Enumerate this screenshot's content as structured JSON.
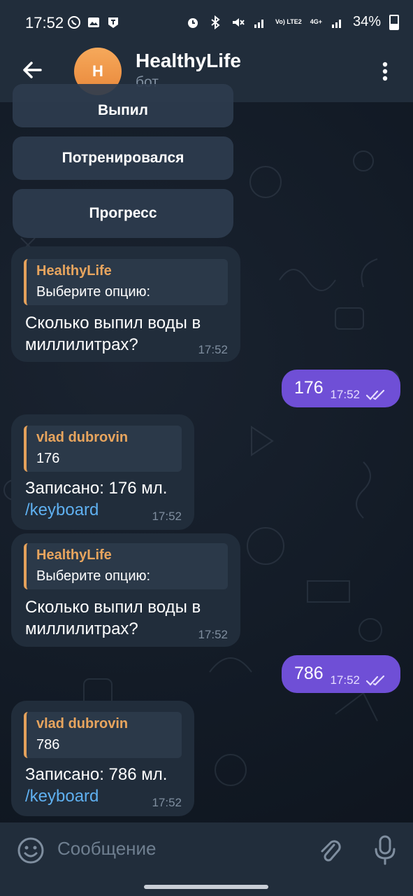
{
  "status_bar": {
    "time": "17:52",
    "battery": "34%",
    "network_tags": [
      "Vo) LTE2",
      "4G+"
    ]
  },
  "header": {
    "avatar_letter": "H",
    "title": "HealthyLife",
    "subtitle": "бот",
    "avatar_color": "#f0964a"
  },
  "keyboard": {
    "buttons": [
      "Выпил",
      "Потренировался",
      "Прогресс"
    ]
  },
  "messages": [
    {
      "type": "bot",
      "quote_name": "HealthyLife",
      "quote_text": "Выберите опцию:",
      "text_line1": "Сколько выпил воды в",
      "text_line2": "миллилитрах?",
      "time": "17:52"
    },
    {
      "type": "user",
      "text": "176",
      "time": "17:52"
    },
    {
      "type": "bot",
      "quote_name": "vlad dubrovin",
      "quote_text": "176",
      "text_line1": "Записано: 176 мл.",
      "text_line2": "/keyboard",
      "time": "17:52"
    },
    {
      "type": "bot",
      "quote_name": "HealthyLife",
      "quote_text": "Выберите опцию:",
      "text_line1": "Сколько выпил воды в",
      "text_line2": "миллилитрах?",
      "time": "17:52"
    },
    {
      "type": "user",
      "text": "786",
      "time": "17:52"
    },
    {
      "type": "bot",
      "quote_name": "vlad dubrovin",
      "quote_text": "786",
      "text_line1": "Записано: 786 мл.",
      "text_line2": "/keyboard",
      "time": "17:52"
    }
  ],
  "composer": {
    "placeholder": "Сообщение"
  },
  "icons": {
    "back": "arrow-left-icon",
    "menu": "more-vertical-icon",
    "emoji": "smile-icon",
    "attach": "paperclip-icon",
    "mic": "microphone-icon",
    "read": "double-check-icon"
  },
  "colors": {
    "accent_user_bubble": "#6f4fd6",
    "bot_bubble": "#212d3b",
    "quote_name": "#e8a55e",
    "link": "#5fb0f0"
  }
}
